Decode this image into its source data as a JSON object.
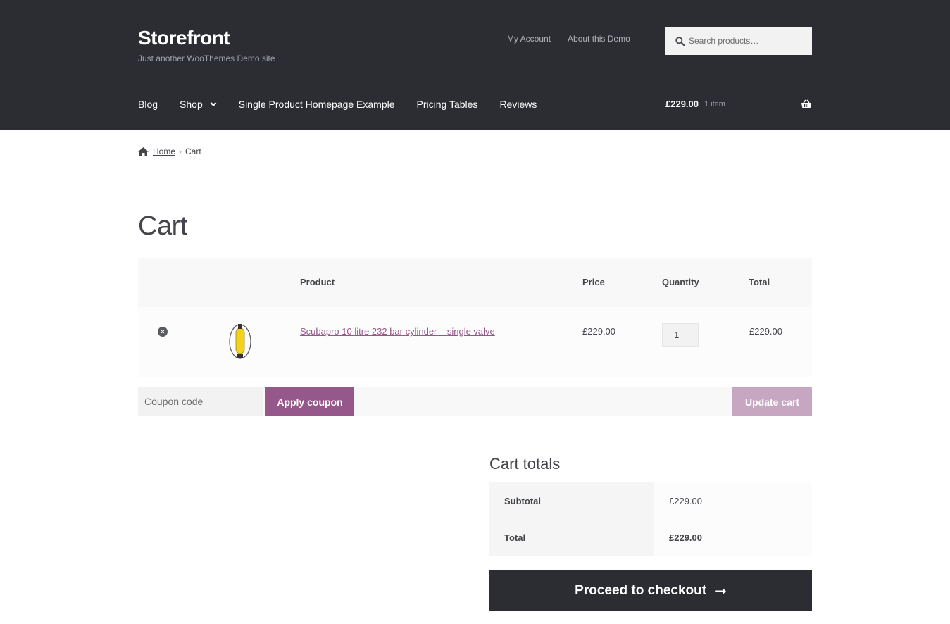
{
  "header": {
    "site_title": "Storefront",
    "tagline": "Just another WooThemes Demo site",
    "secondary_nav": [
      "My Account",
      "About this Demo"
    ],
    "search_placeholder": "Search products…",
    "primary_nav": [
      "Blog",
      "Shop",
      "Single Product Homepage Example",
      "Pricing Tables",
      "Reviews"
    ],
    "mini_cart": {
      "amount": "£229.00",
      "count": "1 item"
    }
  },
  "breadcrumb": {
    "home": "Home",
    "current": "Cart"
  },
  "page_title": "Cart",
  "cart_table": {
    "headers": {
      "product": "Product",
      "price": "Price",
      "quantity": "Quantity",
      "total": "Total"
    },
    "items": [
      {
        "name": "Scubapro 10 litre 232 bar cylinder – single valve",
        "price": "£229.00",
        "quantity": "1",
        "total": "£229.00"
      }
    ]
  },
  "actions": {
    "coupon_placeholder": "Coupon code",
    "apply_label": "Apply coupon",
    "update_label": "Update cart"
  },
  "cart_totals": {
    "title": "Cart totals",
    "subtotal_label": "Subtotal",
    "subtotal_value": "£229.00",
    "total_label": "Total",
    "total_value": "£229.00"
  },
  "checkout_label": "Proceed to checkout",
  "colors": {
    "header_bg": "#2c2d33",
    "accent": "#96588a",
    "accent_disabled": "#c7a6c1"
  }
}
